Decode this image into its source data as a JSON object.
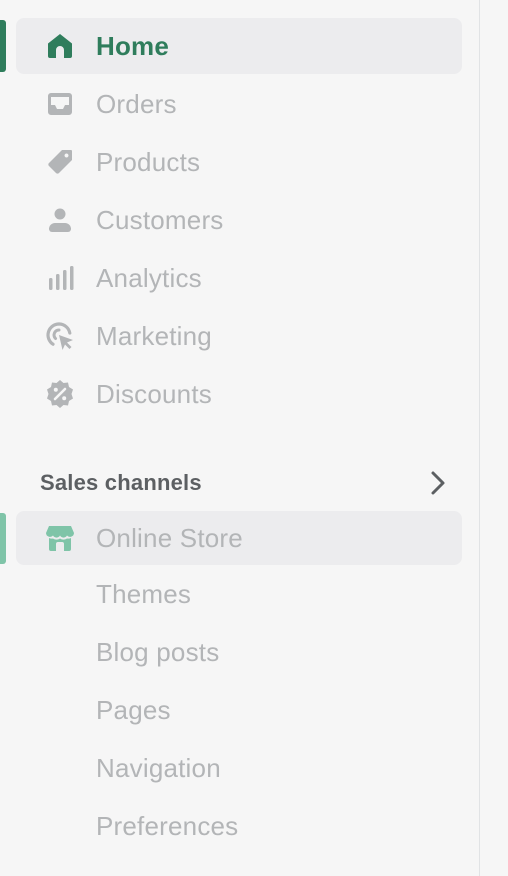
{
  "nav": {
    "items": [
      {
        "label": "Home",
        "icon": "home-icon"
      },
      {
        "label": "Orders",
        "icon": "inbox-icon"
      },
      {
        "label": "Products",
        "icon": "tag-icon"
      },
      {
        "label": "Customers",
        "icon": "person-icon"
      },
      {
        "label": "Analytics",
        "icon": "bar-chart-icon"
      },
      {
        "label": "Marketing",
        "icon": "target-cursor-icon"
      },
      {
        "label": "Discounts",
        "icon": "discount-badge-icon"
      }
    ]
  },
  "sales_channels": {
    "title": "Sales channels",
    "channel": {
      "label": "Online Store",
      "icon": "store-icon"
    },
    "sub_items": [
      "Themes",
      "Blog posts",
      "Pages",
      "Navigation",
      "Preferences"
    ]
  },
  "colors": {
    "accent": "#2f7d5c",
    "accent_light": "#7fc4a8",
    "icon_inactive": "#b3b5b7",
    "text_inactive": "#b3b5b7",
    "selected_bg": "#ececee",
    "background": "#f6f6f6"
  }
}
